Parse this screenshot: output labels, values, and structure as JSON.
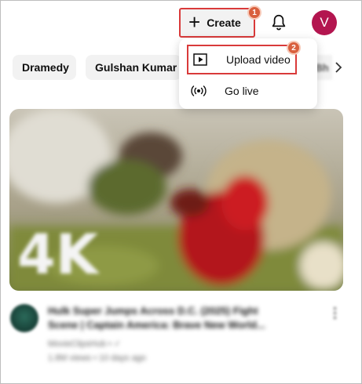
{
  "header": {
    "create_label": "Create",
    "create_step": "1",
    "avatar_letter": "V"
  },
  "chips": {
    "items": [
      "Dramedy",
      "Gulshan Kumar"
    ],
    "partial": "Bh"
  },
  "menu": {
    "upload_label": "Upload video",
    "upload_step": "2",
    "live_label": "Go live"
  },
  "video": {
    "thumbnail_text": "4K",
    "title_line1": "Hulk Super Jumps Across D.C. (2025) Fight",
    "title_line2": "Scene | Captain America: Brave New World...",
    "channel": "MovieClipsHub • ✓",
    "stats": "1.8M views • 10 days ago"
  },
  "colors": {
    "highlight": "#d93a3a",
    "badge": "#d9603e",
    "avatar_bg": "#b3154f"
  }
}
